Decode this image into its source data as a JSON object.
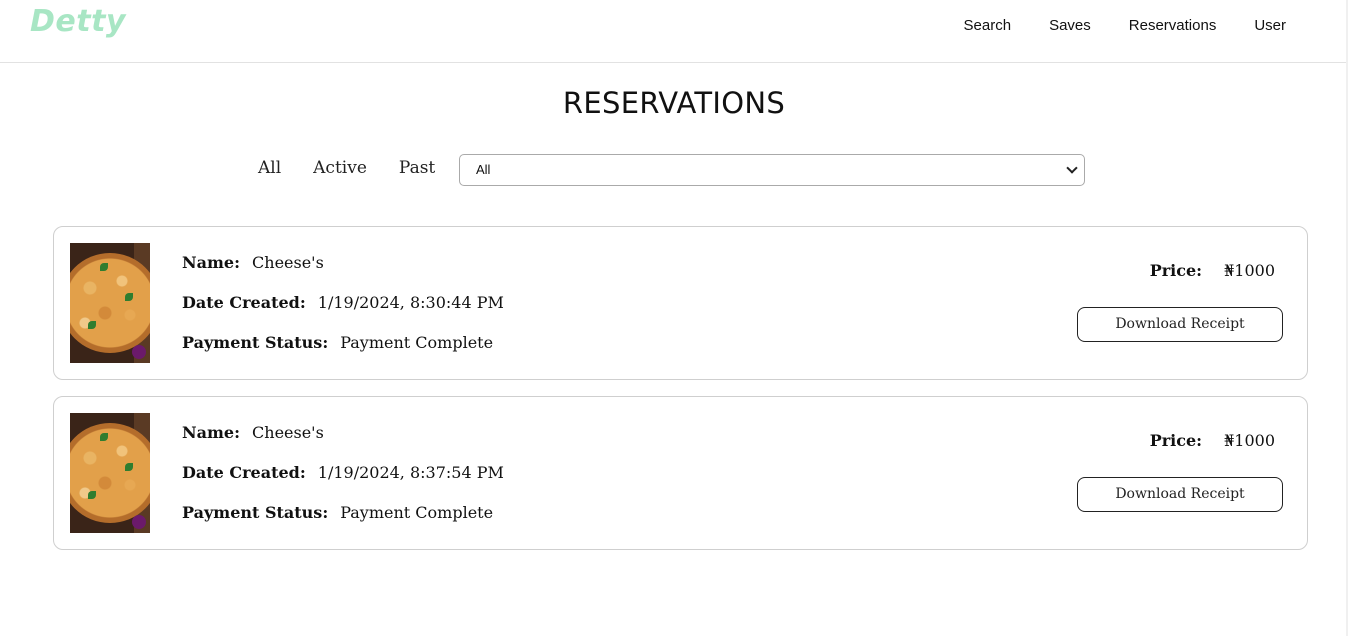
{
  "header": {
    "logo": "Detty",
    "nav": [
      "Search",
      "Saves",
      "Reservations",
      "User"
    ]
  },
  "page_title": "RESERVATIONS",
  "filters": {
    "tabs": [
      "All",
      "Active",
      "Past"
    ],
    "select_value": "All"
  },
  "reservations": [
    {
      "name_label": "Name:",
      "name": "Cheese's",
      "date_label": "Date Created:",
      "date": "1/19/2024, 8:30:44 PM",
      "status_label": "Payment Status:",
      "status": "Payment Complete",
      "price_label": "Price:",
      "price": "₦1000",
      "button": "Download Receipt"
    },
    {
      "name_label": "Name:",
      "name": "Cheese's",
      "date_label": "Date Created:",
      "date": "1/19/2024, 8:37:54 PM",
      "status_label": "Payment Status:",
      "status": "Payment Complete",
      "price_label": "Price:",
      "price": "₦1000",
      "button": "Download Receipt"
    }
  ],
  "colors": {
    "logo": "#a8e6c4",
    "card_border": "#cfcfcf",
    "text": "#111111"
  },
  "icons": {
    "select_arrow": "chevron-down-icon",
    "thumbnail": "pizza-image"
  }
}
